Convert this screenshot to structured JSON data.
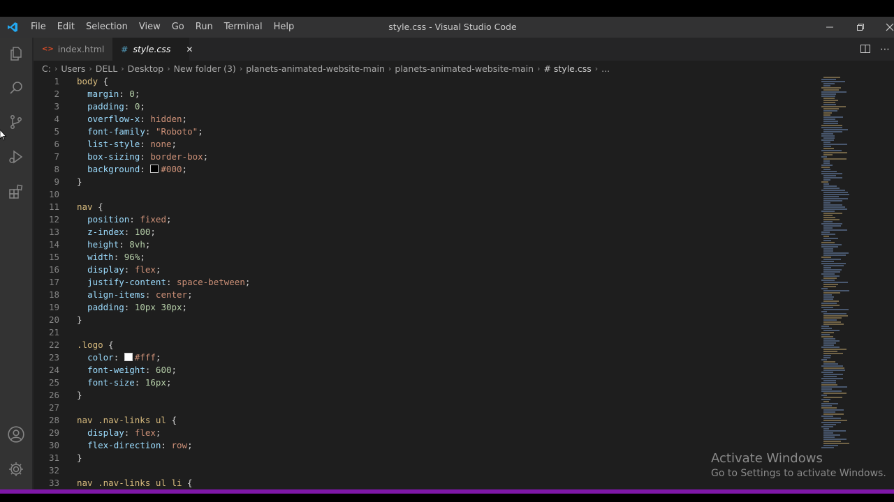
{
  "window": {
    "title": "style.css - Visual Studio Code",
    "minimize": "—",
    "restore": "❐",
    "close": "✕"
  },
  "menu": [
    "File",
    "Edit",
    "Selection",
    "View",
    "Go",
    "Run",
    "Terminal",
    "Help"
  ],
  "activity": [
    "explorer-icon",
    "search-icon",
    "source-control-icon",
    "run-debug-icon",
    "extensions-icon",
    "account-icon",
    "settings-gear-icon"
  ],
  "tabs": [
    {
      "label": "index.html",
      "icon": "<>",
      "icon_color": "#e44d26",
      "active": false
    },
    {
      "label": "style.css",
      "icon": "#",
      "icon_color": "#519aba",
      "active": true,
      "close": "✕"
    }
  ],
  "breadcrumb": [
    "C:",
    "Users",
    "DELL",
    "Desktop",
    "New folder (3)",
    "planets-animated-website-main",
    "planets-animated-website-main",
    "# style.css",
    "..."
  ],
  "editor": {
    "lines": [
      [
        [
          "t-sel",
          "body"
        ],
        [
          "t-p",
          " {"
        ]
      ],
      [
        [
          "t-p",
          "  "
        ],
        [
          "t-prop",
          "margin"
        ],
        [
          "t-p",
          ": "
        ],
        [
          "t-num",
          "0"
        ],
        [
          "t-p",
          ";"
        ]
      ],
      [
        [
          "t-p",
          "  "
        ],
        [
          "t-prop",
          "padding"
        ],
        [
          "t-p",
          ": "
        ],
        [
          "t-num",
          "0"
        ],
        [
          "t-p",
          ";"
        ]
      ],
      [
        [
          "t-p",
          "  "
        ],
        [
          "t-prop",
          "overflow-x"
        ],
        [
          "t-p",
          ": "
        ],
        [
          "t-val",
          "hidden"
        ],
        [
          "t-p",
          ";"
        ]
      ],
      [
        [
          "t-p",
          "  "
        ],
        [
          "t-prop",
          "font-family"
        ],
        [
          "t-p",
          ": "
        ],
        [
          "t-val",
          "\"Roboto\""
        ],
        [
          "t-p",
          ";"
        ]
      ],
      [
        [
          "t-p",
          "  "
        ],
        [
          "t-prop",
          "list-style"
        ],
        [
          "t-p",
          ": "
        ],
        [
          "t-val",
          "none"
        ],
        [
          "t-p",
          ";"
        ]
      ],
      [
        [
          "t-p",
          "  "
        ],
        [
          "t-prop",
          "box-sizing"
        ],
        [
          "t-p",
          ": "
        ],
        [
          "t-val",
          "border-box"
        ],
        [
          "t-p",
          ";"
        ]
      ],
      [
        [
          "t-p",
          "  "
        ],
        [
          "t-prop",
          "background"
        ],
        [
          "t-p",
          ": "
        ],
        [
          "swatch",
          "#000"
        ],
        [
          "t-val",
          "#000"
        ],
        [
          "t-p",
          ";"
        ]
      ],
      [
        [
          "t-p",
          "}"
        ]
      ],
      [],
      [
        [
          "t-sel",
          "nav"
        ],
        [
          "t-p",
          " {"
        ]
      ],
      [
        [
          "t-p",
          "  "
        ],
        [
          "t-prop",
          "position"
        ],
        [
          "t-p",
          ": "
        ],
        [
          "t-val",
          "fixed"
        ],
        [
          "t-p",
          ";"
        ]
      ],
      [
        [
          "t-p",
          "  "
        ],
        [
          "t-prop",
          "z-index"
        ],
        [
          "t-p",
          ": "
        ],
        [
          "t-num",
          "100"
        ],
        [
          "t-p",
          ";"
        ]
      ],
      [
        [
          "t-p",
          "  "
        ],
        [
          "t-prop",
          "height"
        ],
        [
          "t-p",
          ": "
        ],
        [
          "t-num",
          "8vh"
        ],
        [
          "t-p",
          ";"
        ]
      ],
      [
        [
          "t-p",
          "  "
        ],
        [
          "t-prop",
          "width"
        ],
        [
          "t-p",
          ": "
        ],
        [
          "t-num",
          "96%"
        ],
        [
          "t-p",
          ";"
        ]
      ],
      [
        [
          "t-p",
          "  "
        ],
        [
          "t-prop",
          "display"
        ],
        [
          "t-p",
          ": "
        ],
        [
          "t-val",
          "flex"
        ],
        [
          "t-p",
          ";"
        ]
      ],
      [
        [
          "t-p",
          "  "
        ],
        [
          "t-prop",
          "justify-content"
        ],
        [
          "t-p",
          ": "
        ],
        [
          "t-val",
          "space-between"
        ],
        [
          "t-p",
          ";"
        ]
      ],
      [
        [
          "t-p",
          "  "
        ],
        [
          "t-prop",
          "align-items"
        ],
        [
          "t-p",
          ": "
        ],
        [
          "t-val",
          "center"
        ],
        [
          "t-p",
          ";"
        ]
      ],
      [
        [
          "t-p",
          "  "
        ],
        [
          "t-prop",
          "padding"
        ],
        [
          "t-p",
          ": "
        ],
        [
          "t-num",
          "10px 30px"
        ],
        [
          "t-p",
          ";"
        ]
      ],
      [
        [
          "t-p",
          "}"
        ]
      ],
      [],
      [
        [
          "t-sel",
          ".logo"
        ],
        [
          "t-p",
          " {"
        ]
      ],
      [
        [
          "t-p",
          "  "
        ],
        [
          "t-prop",
          "color"
        ],
        [
          "t-p",
          ": "
        ],
        [
          "swatch",
          "#fff"
        ],
        [
          "t-val",
          "#fff"
        ],
        [
          "t-p",
          ";"
        ]
      ],
      [
        [
          "t-p",
          "  "
        ],
        [
          "t-prop",
          "font-weight"
        ],
        [
          "t-p",
          ": "
        ],
        [
          "t-num",
          "600"
        ],
        [
          "t-p",
          ";"
        ]
      ],
      [
        [
          "t-p",
          "  "
        ],
        [
          "t-prop",
          "font-size"
        ],
        [
          "t-p",
          ": "
        ],
        [
          "t-num",
          "16px"
        ],
        [
          "t-p",
          ";"
        ]
      ],
      [
        [
          "t-p",
          "}"
        ]
      ],
      [],
      [
        [
          "t-sel",
          "nav .nav-links ul"
        ],
        [
          "t-p",
          " {"
        ]
      ],
      [
        [
          "t-p",
          "  "
        ],
        [
          "t-prop",
          "display"
        ],
        [
          "t-p",
          ": "
        ],
        [
          "t-val",
          "flex"
        ],
        [
          "t-p",
          ";"
        ]
      ],
      [
        [
          "t-p",
          "  "
        ],
        [
          "t-prop",
          "flex-direction"
        ],
        [
          "t-p",
          ": "
        ],
        [
          "t-val",
          "row"
        ],
        [
          "t-p",
          ";"
        ]
      ],
      [
        [
          "t-p",
          "}"
        ]
      ],
      [],
      [
        [
          "t-sel",
          "nav .nav-links ul li"
        ],
        [
          "t-p",
          " {"
        ]
      ]
    ]
  },
  "watermark": {
    "line1": "Activate Windows",
    "line2": "Go to Settings to activate Windows."
  },
  "colors": {
    "statusbar": "#7e17a8",
    "vscode_blue": "#0a7acc"
  }
}
